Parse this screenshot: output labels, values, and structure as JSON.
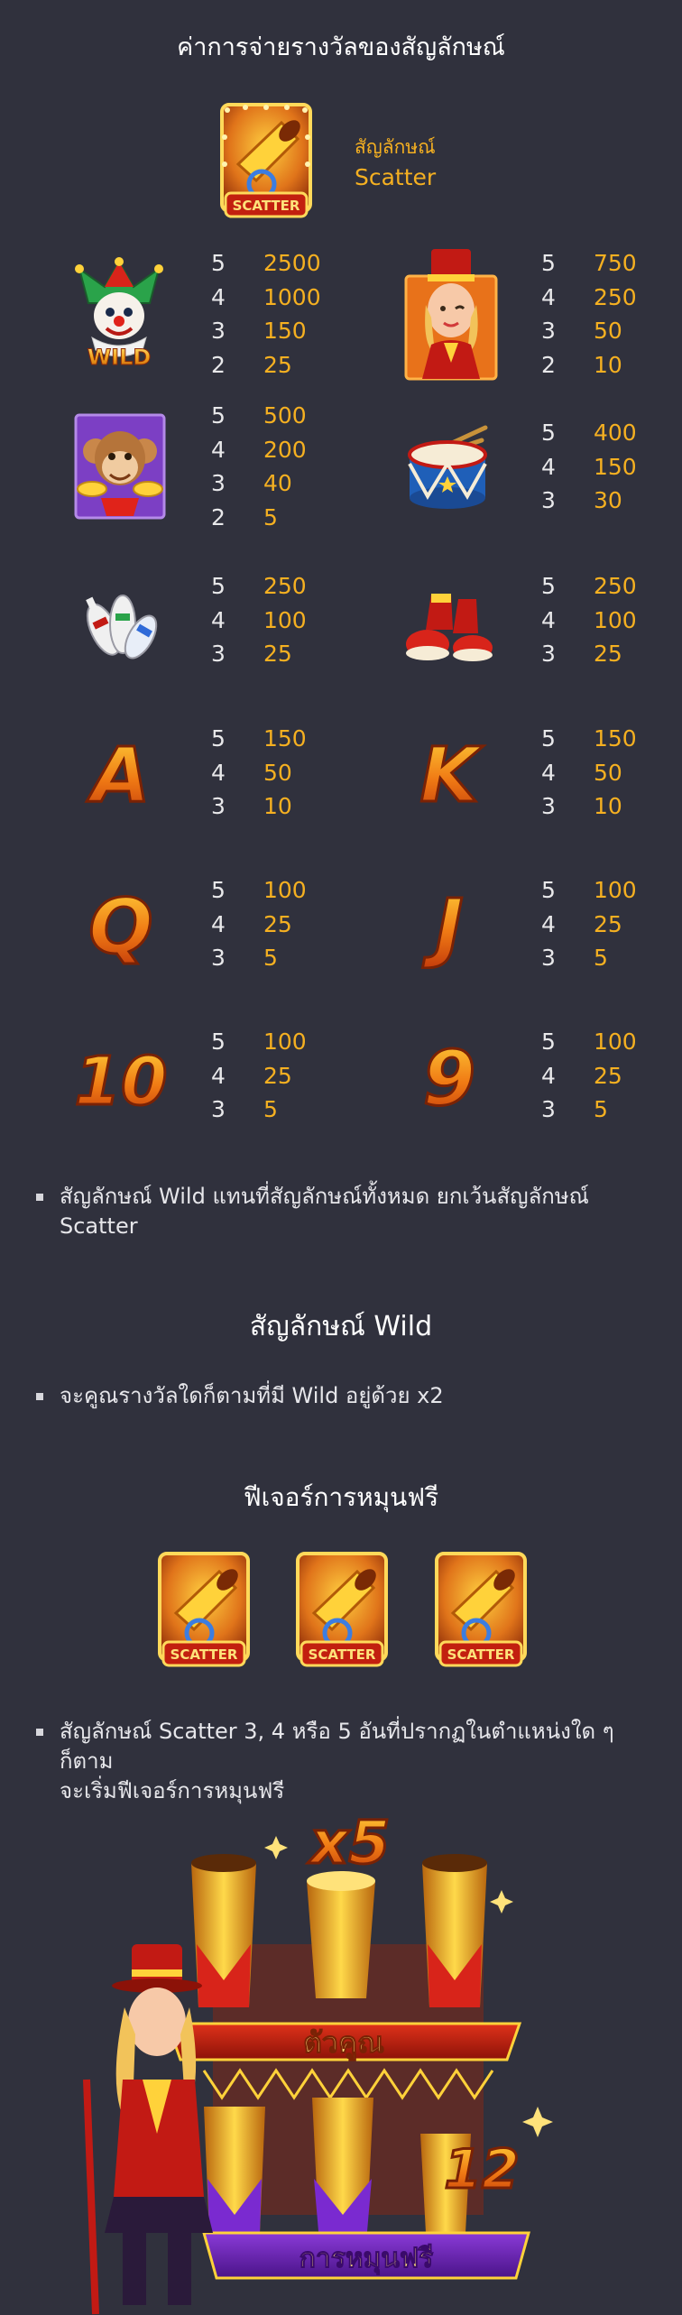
{
  "page_title": "ค่าการจ่ายรางวัลของสัญลักษณ์",
  "scatter_info": {
    "line1": "สัญลักษณ์",
    "line2": "Scatter"
  },
  "icon_text": {
    "scatter": "SCATTER",
    "wild": "WILD"
  },
  "symbols": [
    {
      "name": "wild",
      "rows": [
        [
          "5",
          "2500"
        ],
        [
          "4",
          "1000"
        ],
        [
          "3",
          "150"
        ],
        [
          "2",
          "25"
        ]
      ]
    },
    {
      "name": "ringmaster-girl",
      "rows": [
        [
          "5",
          "750"
        ],
        [
          "4",
          "250"
        ],
        [
          "3",
          "50"
        ],
        [
          "2",
          "10"
        ]
      ]
    },
    {
      "name": "monkey",
      "rows": [
        [
          "5",
          "500"
        ],
        [
          "4",
          "200"
        ],
        [
          "3",
          "40"
        ],
        [
          "2",
          "5"
        ]
      ]
    },
    {
      "name": "drum",
      "rows": [
        [
          "5",
          "400"
        ],
        [
          "4",
          "150"
        ],
        [
          "3",
          "30"
        ]
      ]
    },
    {
      "name": "juggling-pins",
      "rows": [
        [
          "5",
          "250"
        ],
        [
          "4",
          "100"
        ],
        [
          "3",
          "25"
        ]
      ]
    },
    {
      "name": "clown-shoes",
      "rows": [
        [
          "5",
          "250"
        ],
        [
          "4",
          "100"
        ],
        [
          "3",
          "25"
        ]
      ]
    },
    {
      "name": "letter-a",
      "letter": "A",
      "rows": [
        [
          "5",
          "150"
        ],
        [
          "4",
          "50"
        ],
        [
          "3",
          "10"
        ]
      ]
    },
    {
      "name": "letter-k",
      "letter": "K",
      "rows": [
        [
          "5",
          "150"
        ],
        [
          "4",
          "50"
        ],
        [
          "3",
          "10"
        ]
      ]
    },
    {
      "name": "letter-q",
      "letter": "Q",
      "rows": [
        [
          "5",
          "100"
        ],
        [
          "4",
          "25"
        ],
        [
          "3",
          "5"
        ]
      ]
    },
    {
      "name": "letter-j",
      "letter": "J",
      "rows": [
        [
          "5",
          "100"
        ],
        [
          "4",
          "25"
        ],
        [
          "3",
          "5"
        ]
      ]
    },
    {
      "name": "number-10",
      "letter": "10",
      "rows": [
        [
          "5",
          "100"
        ],
        [
          "4",
          "25"
        ],
        [
          "3",
          "5"
        ]
      ]
    },
    {
      "name": "number-9",
      "letter": "9",
      "rows": [
        [
          "5",
          "100"
        ],
        [
          "4",
          "25"
        ],
        [
          "3",
          "5"
        ]
      ]
    }
  ],
  "wild_note": {
    "line1": "สัญลักษณ์ Wild แทนที่สัญลักษณ์ทั้งหมด ยกเว้นสัญลักษณ์",
    "line2": "Scatter"
  },
  "wild_section": {
    "title": "สัญลักษณ์ Wild",
    "bullet": "จะคูณรางวัลใดก็ตามที่มี Wild อยู่ด้วย x2"
  },
  "free_spin_section": {
    "title": "ฟีเจอร์การหมุนฟรี",
    "bullet_line1": "สัญลักษณ์ Scatter 3, 4 หรือ 5 อันที่ปรากฏในตำแหน่งใด ๆ ก็ตาม",
    "bullet_line2": "จะเริ่มฟีเจอร์การหมุนฟรี"
  },
  "feature_art": {
    "multiplier": "x5",
    "multiplier_label": "ตัวคูณ",
    "spins": "12",
    "spins_label": "การหมุนฟรี"
  },
  "colors": {
    "background": "#30313d",
    "accent": "#f5b021",
    "text": "#e8e8ea"
  }
}
